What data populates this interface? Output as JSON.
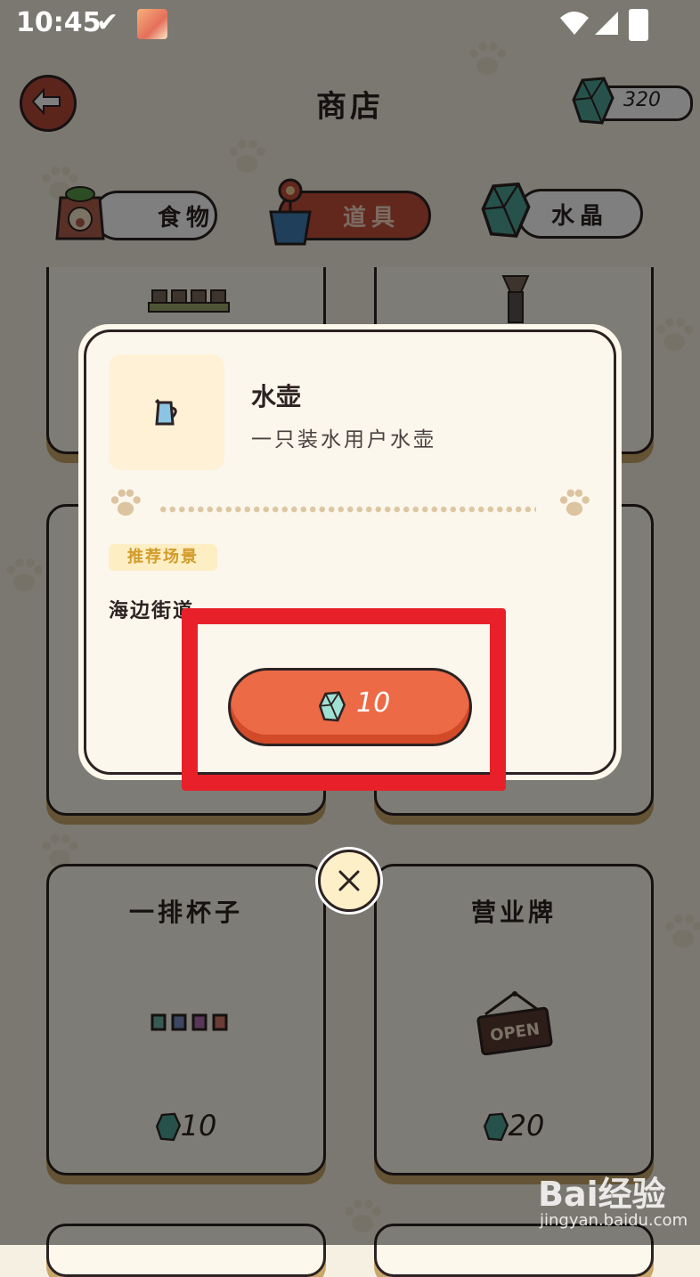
{
  "status_bar": {
    "time": "10:45",
    "check": "✔"
  },
  "header": {
    "title": "商店",
    "balance": "320"
  },
  "tabs": [
    {
      "label": "食物",
      "icon": "food-bag-icon",
      "active": false
    },
    {
      "label": "道具",
      "icon": "flower-pot-icon",
      "active": true
    },
    {
      "label": "水晶",
      "icon": "crystal-icon",
      "active": false
    }
  ],
  "cards": [
    {
      "title": "一排杯子",
      "price": "10",
      "icon": "cups-row-icon"
    },
    {
      "title": "营业牌",
      "price": "20",
      "icon": "open-sign-icon",
      "sign_text": "OPEN"
    }
  ],
  "modal": {
    "item_name": "水壶",
    "item_desc": "一只装水用户水壶",
    "tag": "推荐场景",
    "scene": "海边街道",
    "buy_price": "10"
  },
  "watermark": {
    "brand": "Bai经验",
    "url": "jingyan.baidu.com"
  },
  "colors": {
    "accent": "#ed6a47",
    "highlight": "#e8202a",
    "tab_active": "#c4503b",
    "gem": "#4fa596"
  }
}
